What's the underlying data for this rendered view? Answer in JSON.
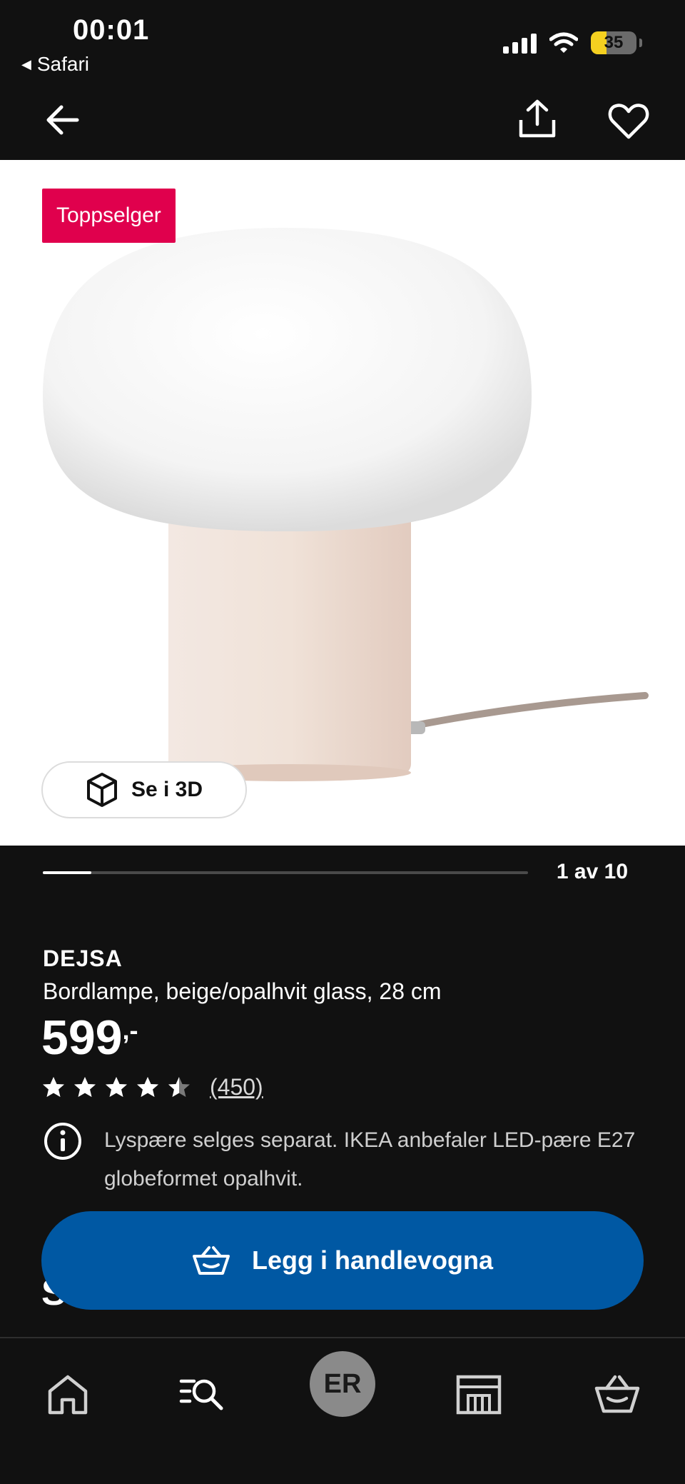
{
  "status_bar": {
    "time": "00:01",
    "back_app": "Safari",
    "battery_level": "35"
  },
  "nav": {
    "back_icon": "arrow-left-icon",
    "share_icon": "share-icon",
    "favorite_icon": "heart-icon"
  },
  "gallery": {
    "badge": "Toppselger",
    "see_3d_label": "Se i 3D",
    "position_label": "1 av 10",
    "position_current": 1,
    "position_total": 10
  },
  "product": {
    "brand": "DEJSA",
    "description": "Bordlampe, beige/opalhvit glass, 28 cm",
    "price": "599",
    "price_suffix": ",-",
    "rating_stars": 4.5,
    "rating_count": "(450)",
    "notice": "Lyspære selges separat. IKEA anbefaler LED-pære E27 globeformet opalhvit.",
    "partial_heading": "Su"
  },
  "cta": {
    "add_to_cart_label": "Legg i handlevogna"
  },
  "tab_bar": {
    "profile_initials": "ER",
    "items": [
      "home-icon",
      "search-icon",
      "profile-avatar",
      "store-icon",
      "cart-icon"
    ]
  },
  "colors": {
    "background": "#111111",
    "badge": "#e0004d",
    "primary_button": "#0058a3"
  }
}
